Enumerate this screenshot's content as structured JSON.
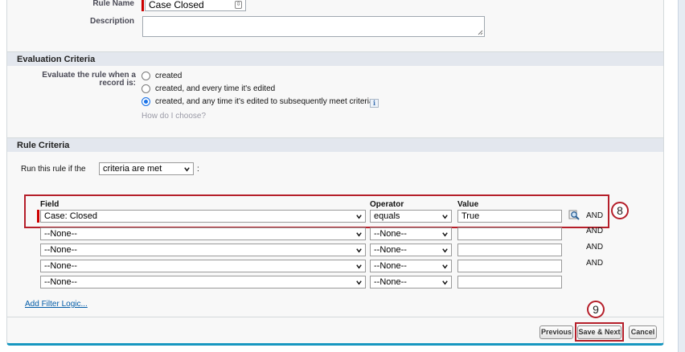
{
  "rule_info": {
    "rule_name_label": "Rule Name",
    "rule_name_value": "Case Closed",
    "description_label": "Description",
    "description_value": ""
  },
  "evaluation": {
    "section_title": "Evaluation Criteria",
    "prompt_label": "Evaluate the rule when a record is:",
    "options": [
      {
        "label": "created",
        "selected": false
      },
      {
        "label": "created, and every time it's edited",
        "selected": false
      },
      {
        "label": "created, and any time it's edited to subsequently meet criteria",
        "selected": true
      }
    ],
    "help_link": "How do I choose?"
  },
  "rule_criteria": {
    "section_title": "Rule Criteria",
    "run_prefix": "Run this rule if the",
    "run_select": "criteria are met",
    "run_suffix": ":",
    "columns": {
      "field": "Field",
      "operator": "Operator",
      "value": "Value"
    },
    "rows": [
      {
        "field": "Case: Closed",
        "operator": "equals",
        "value": "True",
        "conj": "AND"
      },
      {
        "field": "--None--",
        "operator": "--None--",
        "value": "",
        "conj": "AND"
      },
      {
        "field": "--None--",
        "operator": "--None--",
        "value": "",
        "conj": "AND"
      },
      {
        "field": "--None--",
        "operator": "--None--",
        "value": "",
        "conj": "AND"
      },
      {
        "field": "--None--",
        "operator": "--None--",
        "value": "",
        "conj": ""
      }
    ],
    "add_filter_logic": "Add Filter Logic..."
  },
  "buttons": {
    "previous": "Previous",
    "save_next": "Save & Next",
    "cancel": "Cancel"
  },
  "callouts": {
    "step_8": "8",
    "step_9": "9"
  },
  "colors": {
    "accent_blue": "#1797c0",
    "highlight_red": "#b51f2a",
    "required_red": "#cc0000",
    "section_bg": "#e3e7ee"
  }
}
